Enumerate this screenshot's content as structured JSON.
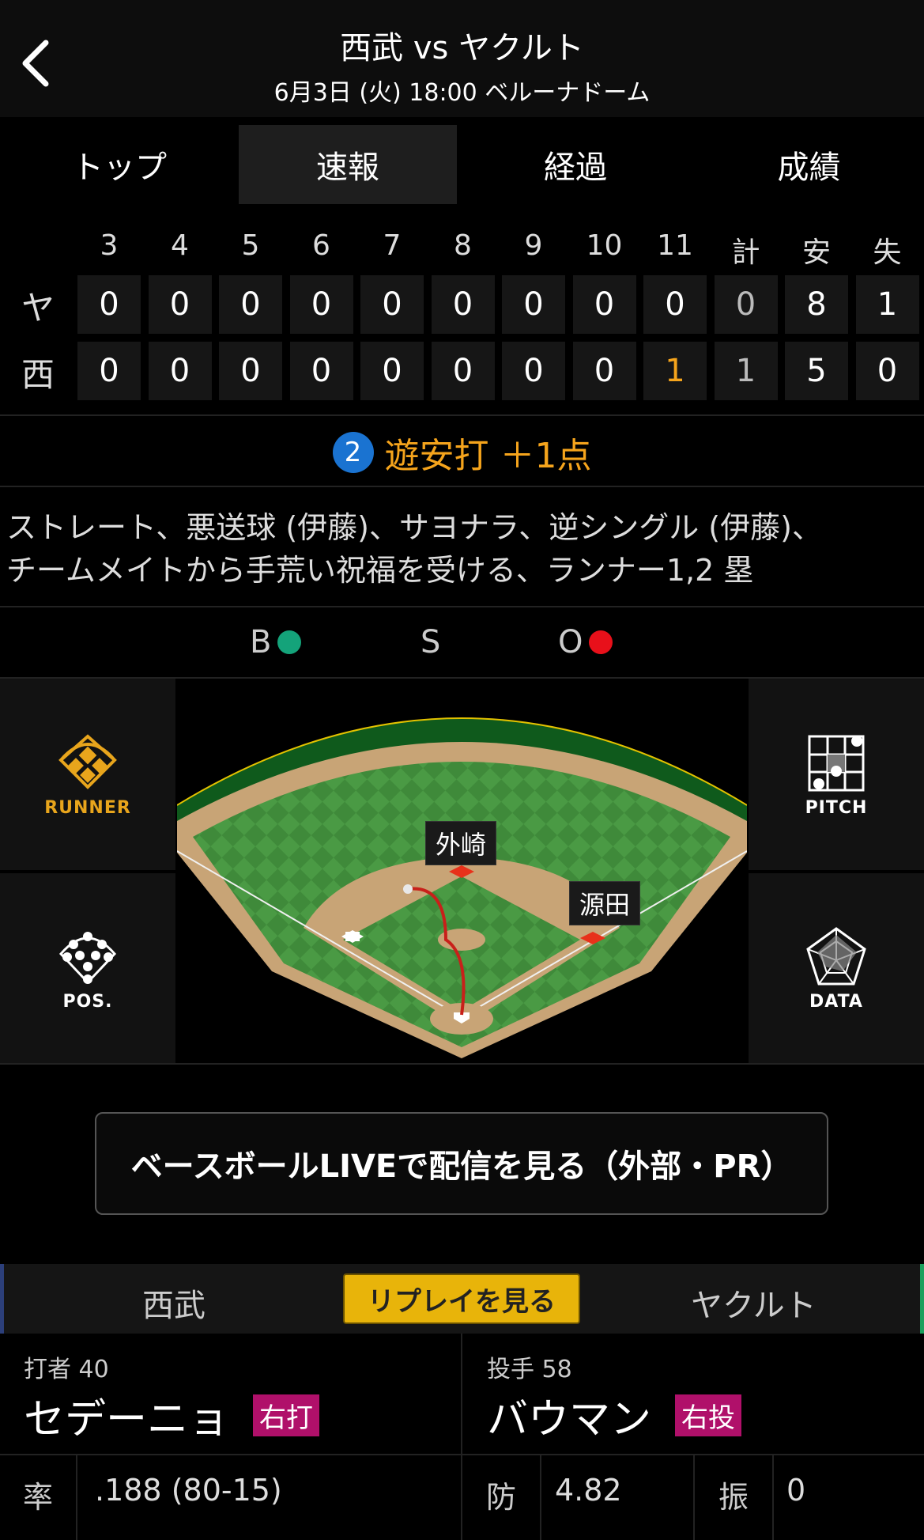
{
  "header": {
    "title": "西武 vs ヤクルト",
    "subtitle": "6月3日 (火) 18:00 ベルーナドーム",
    "back_icon": "chevron-left-icon"
  },
  "tabs": [
    {
      "label": "トップ",
      "active": false
    },
    {
      "label": "速報",
      "active": true
    },
    {
      "label": "経過",
      "active": false
    },
    {
      "label": "成績",
      "active": false
    }
  ],
  "scoreboard": {
    "columns": [
      "3",
      "4",
      "5",
      "6",
      "7",
      "8",
      "9",
      "10",
      "11",
      "計",
      "安",
      "失"
    ],
    "rows": [
      {
        "team": "ヤ",
        "values": [
          "0",
          "0",
          "0",
          "0",
          "0",
          "0",
          "0",
          "0",
          "0",
          "0",
          "8",
          "1"
        ]
      },
      {
        "team": "西",
        "values": [
          "0",
          "0",
          "0",
          "0",
          "0",
          "0",
          "0",
          "0",
          "1",
          "1",
          "5",
          "0"
        ]
      }
    ]
  },
  "result": {
    "number": "2",
    "text": "遊安打 ＋1点",
    "description_line1": "ストレート、悪送球 (伊藤)、サヨナラ、逆シングル (伊藤)、",
    "description_line2": "チームメイトから手荒い祝福を受ける、ランナー1,2 塁"
  },
  "count": {
    "ball_label": "B",
    "strike_label": "S",
    "out_label": "O",
    "ball_color": "#14a37a",
    "out_color": "#e8101a"
  },
  "field": {
    "runner_label": "RUNNER",
    "pos_label": "POS.",
    "pitch_label": "PITCH",
    "data_label": "DATA",
    "player_2b": "外崎",
    "player_1b": "源田"
  },
  "live_button": "ベースボールLIVEで配信を見る（外部・PR）",
  "team_bar": {
    "home": "西武",
    "replay": "リプレイを見る",
    "away": "ヤクルト"
  },
  "batter": {
    "label": "打者 40",
    "name": "セデーニョ",
    "badge": "右打"
  },
  "pitcher": {
    "label": "投手 58",
    "name": "バウマン",
    "badge": "右投"
  },
  "stats": {
    "batter_key": "率",
    "batter_val": ".188 (80-15)",
    "pitcher_key1": "防",
    "pitcher_val1": "4.82",
    "pitcher_key2": "振",
    "pitcher_val2": "0"
  }
}
